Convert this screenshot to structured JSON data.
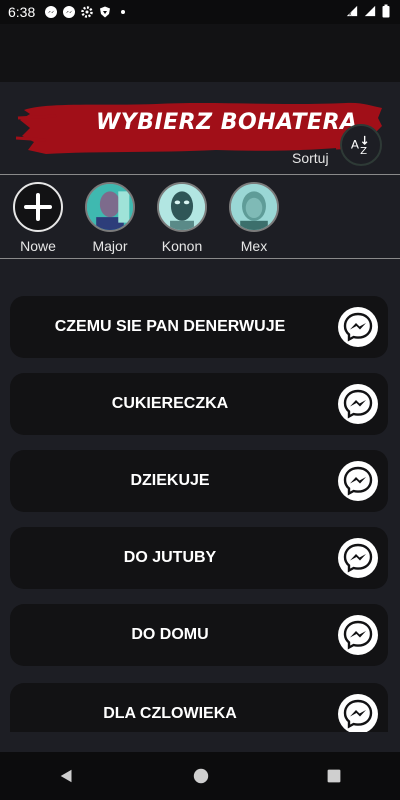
{
  "status_bar": {
    "time": "6:38",
    "left_icons": [
      "messenger-icon",
      "messenger-icon",
      "gear-icon",
      "shield-icon",
      "dot-icon"
    ],
    "right_icons": [
      "wifi-icon",
      "signal-icon",
      "battery-icon"
    ]
  },
  "header": {
    "title": "WYBIERZ BOHATERA",
    "sort_label": "Sortuj",
    "sort_icon": "az-sort-icon",
    "accent_color": "#a10f18"
  },
  "heroes": [
    {
      "label": "Nowe",
      "icon": "plus-icon"
    },
    {
      "label": "Major",
      "icon": "avatar-icon"
    },
    {
      "label": "Konon",
      "icon": "avatar-icon"
    },
    {
      "label": "Mex",
      "icon": "avatar-icon"
    }
  ],
  "sounds": [
    {
      "label": "CZEMU SIE PAN DENERWUJE",
      "icon": "messenger-icon"
    },
    {
      "label": "CUKIERECZKA",
      "icon": "messenger-icon"
    },
    {
      "label": "DZIEKUJE",
      "icon": "messenger-icon"
    },
    {
      "label": "DO JUTUBY",
      "icon": "messenger-icon"
    },
    {
      "label": "DO DOMU",
      "icon": "messenger-icon"
    },
    {
      "label": "DLA CZLOWIEKA",
      "icon": "messenger-icon"
    }
  ],
  "nav": [
    "back-icon",
    "home-icon",
    "recents-icon"
  ]
}
